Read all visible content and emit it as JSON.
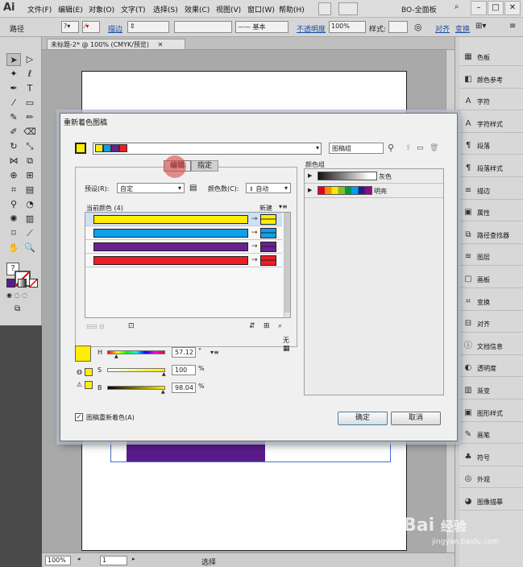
{
  "app": {
    "logo": "Ai",
    "workspace": "BO-全面板"
  },
  "menu": [
    "文件(F)",
    "编辑(E)",
    "对象(O)",
    "文字(T)",
    "选择(S)",
    "效果(C)",
    "视图(V)",
    "窗口(W)",
    "帮助(H)"
  ],
  "control": {
    "path_label": "路径",
    "stroke_label": "描边",
    "stroke_style": "基本",
    "opacity_label": "不透明度",
    "opacity_value": "100%",
    "style_label": "样式:",
    "align_label": "对齐",
    "transform_label": "变换"
  },
  "document": {
    "tab_title": "未标题-2* @ 100% (CMYK/预览)"
  },
  "status": {
    "zoom": "100%",
    "page": "1",
    "tool": "选择"
  },
  "right_panels": [
    "色板",
    "颜色参考",
    "字符",
    "字符样式",
    "段落",
    "段落样式",
    "描边",
    "属性",
    "路径查找器",
    "图层",
    "画板",
    "变换",
    "对齐",
    "文档信息",
    "透明度",
    "渐变",
    "图形样式",
    "画笔",
    "符号",
    "外观",
    "图像描摹"
  ],
  "right_panel_icons": [
    "swatches-icon",
    "color-guide-icon",
    "character-icon",
    "character-style-icon",
    "paragraph-icon",
    "paragraph-style-icon",
    "stroke-icon",
    "attributes-icon",
    "pathfinder-icon",
    "layers-icon",
    "artboards-icon",
    "transform-icon",
    "align-icon",
    "document-info-icon",
    "transparency-icon",
    "gradient-icon",
    "graphic-styles-icon",
    "brushes-icon",
    "symbols-icon",
    "appearance-icon",
    "image-trace-icon"
  ],
  "dialog": {
    "title": "重新着色图稿",
    "group_name": "图稿组",
    "tab_edit": "编辑",
    "tab_assign": "指定",
    "preset_label": "预设(R):",
    "preset_value": "自定",
    "colors_label": "颜色数(C):",
    "colors_value": "自动",
    "current_colors_label": "当前颜色 (4)",
    "new_label": "新建",
    "color_groups_label": "颜色组",
    "groups": [
      {
        "name": "灰色"
      },
      {
        "name": "明亮"
      }
    ],
    "rows": [
      {
        "color": "#ffee00"
      },
      {
        "color": "#10a0e8"
      },
      {
        "color": "#6a1f94"
      },
      {
        "color": "#ee1c24"
      }
    ],
    "hue_label": "H",
    "hue_value": "57.12",
    "hue_unit": "°",
    "sat_label": "S",
    "sat_value": "100",
    "sat_unit": "%",
    "bri_label": "B",
    "bri_value": "98.04",
    "bri_unit": "%",
    "none_label": "无",
    "recolor_checkbox": "图稿重新着色(A)",
    "ok": "确定",
    "cancel": "取消"
  },
  "colors": {
    "yellow": "#ffee00",
    "blue": "#10a0e8",
    "purple": "#6a1f94",
    "red": "#ee1c24",
    "highlight": "#d9534f"
  },
  "watermark": {
    "brand": "Bai",
    "brand2": "经验",
    "url": "jingyan.baidu.com"
  }
}
